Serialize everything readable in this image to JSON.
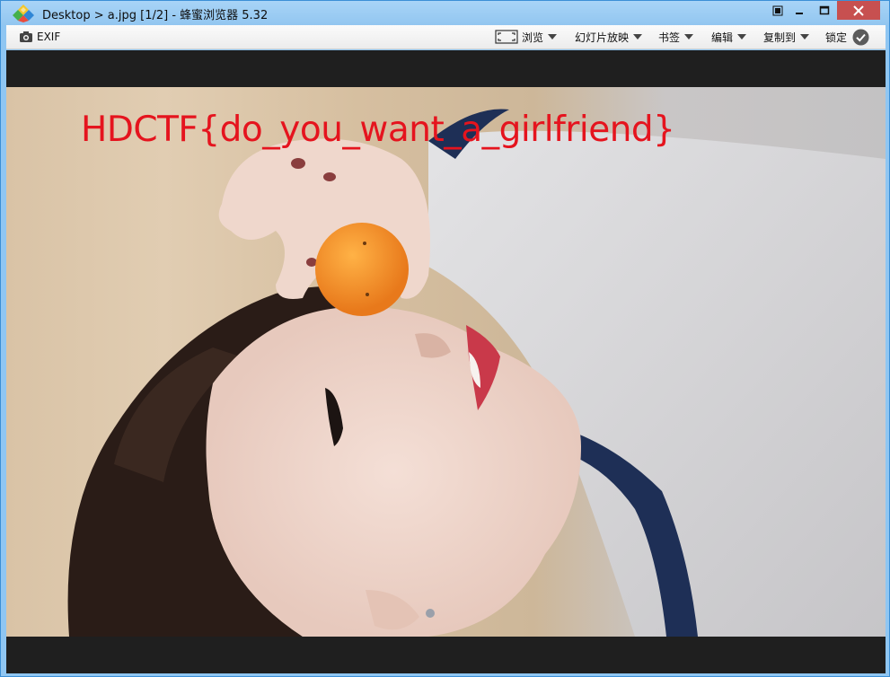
{
  "window": {
    "title": "Desktop > a.jpg [1/2] - 蜂蜜浏览器 5.32"
  },
  "toolbar": {
    "exif_label": "EXIF",
    "browse_label": "浏览",
    "slideshow_label": "幻灯片放映",
    "bookmark_label": "书签",
    "edit_label": "编辑",
    "copyto_label": "复制到",
    "lock_label": "锁定"
  },
  "image": {
    "overlay_text": "HDCTF{do_you_want_a_girlfriend}"
  },
  "colors": {
    "titlebar": "#a8d4f7",
    "close_button": "#c75050",
    "viewer_bg": "#1f1f1f",
    "overlay_text": "#e5141e"
  },
  "icons": {
    "app": "honeyview-logo-icon",
    "exif": "camera-icon",
    "browse": "fullscreen-frame-icon",
    "lock": "check-circle-icon"
  }
}
